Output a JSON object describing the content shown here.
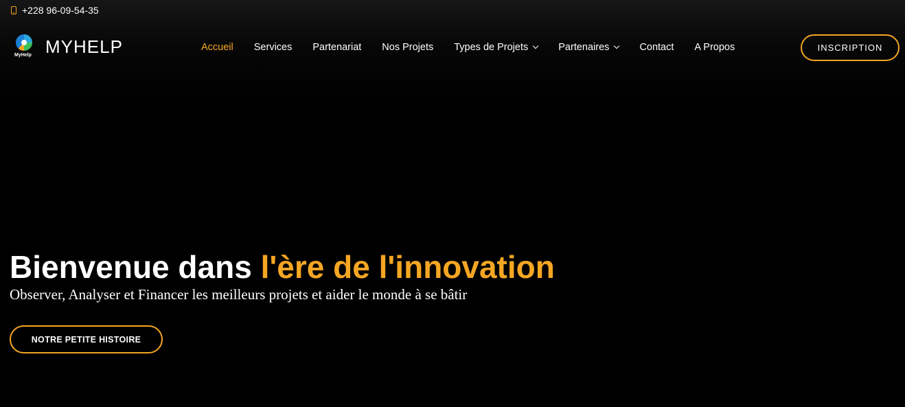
{
  "topbar": {
    "phone": "+228 96-09-54-35"
  },
  "brand": {
    "logo_caption": "MyHelp",
    "name": "MYHELP"
  },
  "nav": {
    "items": [
      {
        "label": "Accueil"
      },
      {
        "label": "Services"
      },
      {
        "label": "Partenariat"
      },
      {
        "label": "Nos Projets"
      },
      {
        "label": "Types de Projets"
      },
      {
        "label": "Partenaires"
      },
      {
        "label": "Contact"
      },
      {
        "label": "A Propos"
      }
    ],
    "cta_label": "INSCRIPTION"
  },
  "hero": {
    "title_white": "Bienvenue dans",
    "title_accent": "l'ère de l'innovation",
    "subtitle": "Observer, Analyser et Financer les meilleurs projets et aider le monde à se bâtir",
    "button_label": "NOTRE PETITE HISTOIRE"
  },
  "colors": {
    "accent": "#f5a623",
    "background": "#000000",
    "text": "#ffffff"
  },
  "icons": [
    "phone-icon",
    "logo-icon",
    "chevron-down-icon"
  ]
}
